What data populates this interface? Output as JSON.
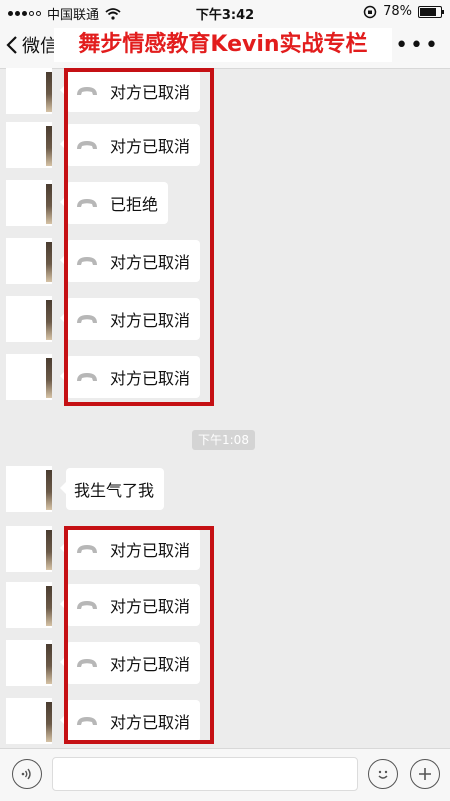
{
  "status_bar": {
    "carrier": "中国联通",
    "time": "下午3:42",
    "battery": "78%",
    "battery_level": 0.78
  },
  "nav": {
    "back_label": "微信",
    "banner": "舞步情感教育Kevin实战专栏",
    "more_label": "•••"
  },
  "messages": [
    {
      "type": "call",
      "text": "对方已取消"
    },
    {
      "type": "call",
      "text": "对方已取消"
    },
    {
      "type": "call",
      "text": "已拒绝"
    },
    {
      "type": "call",
      "text": "对方已取消"
    },
    {
      "type": "call",
      "text": "对方已取消"
    },
    {
      "type": "call",
      "text": "对方已取消"
    },
    {
      "type": "timestamp",
      "text": "下午1:08"
    },
    {
      "type": "text",
      "text": "我生气了我"
    },
    {
      "type": "call",
      "text": "对方已取消"
    },
    {
      "type": "call",
      "text": "对方已取消"
    },
    {
      "type": "call",
      "text": "对方已取消"
    },
    {
      "type": "call",
      "text": "对方已取消"
    }
  ],
  "input_bar": {
    "placeholder": ""
  },
  "colors": {
    "highlight": "#c51014",
    "banner_text": "#e21d1d",
    "chat_bg": "#ececec"
  }
}
